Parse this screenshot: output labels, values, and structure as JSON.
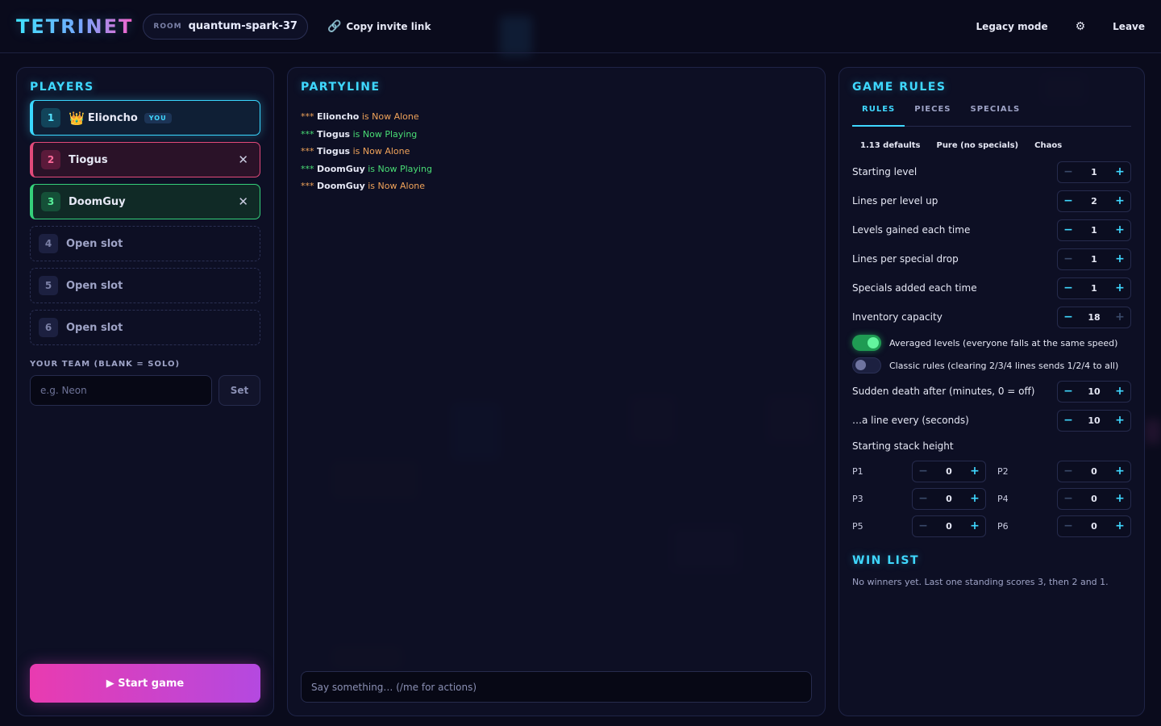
{
  "header": {
    "logo": "TETRINET",
    "room_label": "ROOM",
    "room_name": "quantum-spark-37",
    "invite_label": "Copy invite link",
    "legacy_label": "Legacy mode",
    "settings_glyph": "⚙",
    "leave_label": "Leave"
  },
  "players": {
    "title": "PLAYERS",
    "slots": [
      {
        "num": "1",
        "name": "Elioncho",
        "badge": "YOU",
        "crown": "👑"
      },
      {
        "num": "2",
        "name": "Tiogus"
      },
      {
        "num": "3",
        "name": "DoomGuy"
      },
      {
        "num": "4",
        "name": "Open slot"
      },
      {
        "num": "5",
        "name": "Open slot"
      },
      {
        "num": "6",
        "name": "Open slot"
      }
    ],
    "team_label": "YOUR TEAM (BLANK = SOLO)",
    "team_placeholder": "e.g. Neon",
    "team_set": "Set",
    "start_label": "▶ Start game"
  },
  "partyline": {
    "title": "PARTYLINE",
    "messages": [
      {
        "stars": "***",
        "who": "Elioncho",
        "msg": "is Now Alone"
      },
      {
        "stars": "***",
        "who": "Tiogus",
        "msg": "is Now Playing"
      },
      {
        "stars": "***",
        "who": "Tiogus",
        "msg": "is Now Alone"
      },
      {
        "stars": "***",
        "who": "DoomGuy",
        "msg": "is Now Playing"
      },
      {
        "stars": "***",
        "who": "DoomGuy",
        "msg": "is Now Alone"
      }
    ],
    "input_placeholder": "Say something… (/me for actions)"
  },
  "rules": {
    "title": "GAME RULES",
    "tabs": [
      "RULES",
      "PIECES",
      "SPECIALS"
    ],
    "presets": [
      "1.13 defaults",
      "Pure (no specials)",
      "Chaos"
    ],
    "steppers": [
      {
        "label": "Starting level",
        "value": "1"
      },
      {
        "label": "Lines per level up",
        "value": "2"
      },
      {
        "label": "Levels gained each time",
        "value": "1"
      },
      {
        "label": "Lines per special drop",
        "value": "1"
      },
      {
        "label": "Specials added each time",
        "value": "1"
      },
      {
        "label": "Inventory capacity",
        "value": "18"
      }
    ],
    "toggles": [
      {
        "label": "Averaged levels (everyone falls at the same speed)",
        "on": true
      },
      {
        "label": "Classic rules (clearing 2/3/4 lines sends 1/2/4 to all)",
        "on": false
      }
    ],
    "sudden": [
      {
        "label": "Sudden death after (minutes, 0 = off)",
        "value": "10"
      },
      {
        "label": "…a line every (seconds)",
        "value": "10"
      }
    ],
    "stack_label": "Starting stack height",
    "stacks": [
      {
        "label": "P1",
        "value": "0"
      },
      {
        "label": "P2",
        "value": "0"
      },
      {
        "label": "P3",
        "value": "0"
      },
      {
        "label": "P4",
        "value": "0"
      },
      {
        "label": "P5",
        "value": "0"
      },
      {
        "label": "P6",
        "value": "0"
      }
    ],
    "minus_glyph": "−",
    "plus_glyph": "+"
  },
  "winlist": {
    "title": "WIN LIST",
    "note": "No winners yet. Last one standing scores 3, then 2 and 1."
  }
}
